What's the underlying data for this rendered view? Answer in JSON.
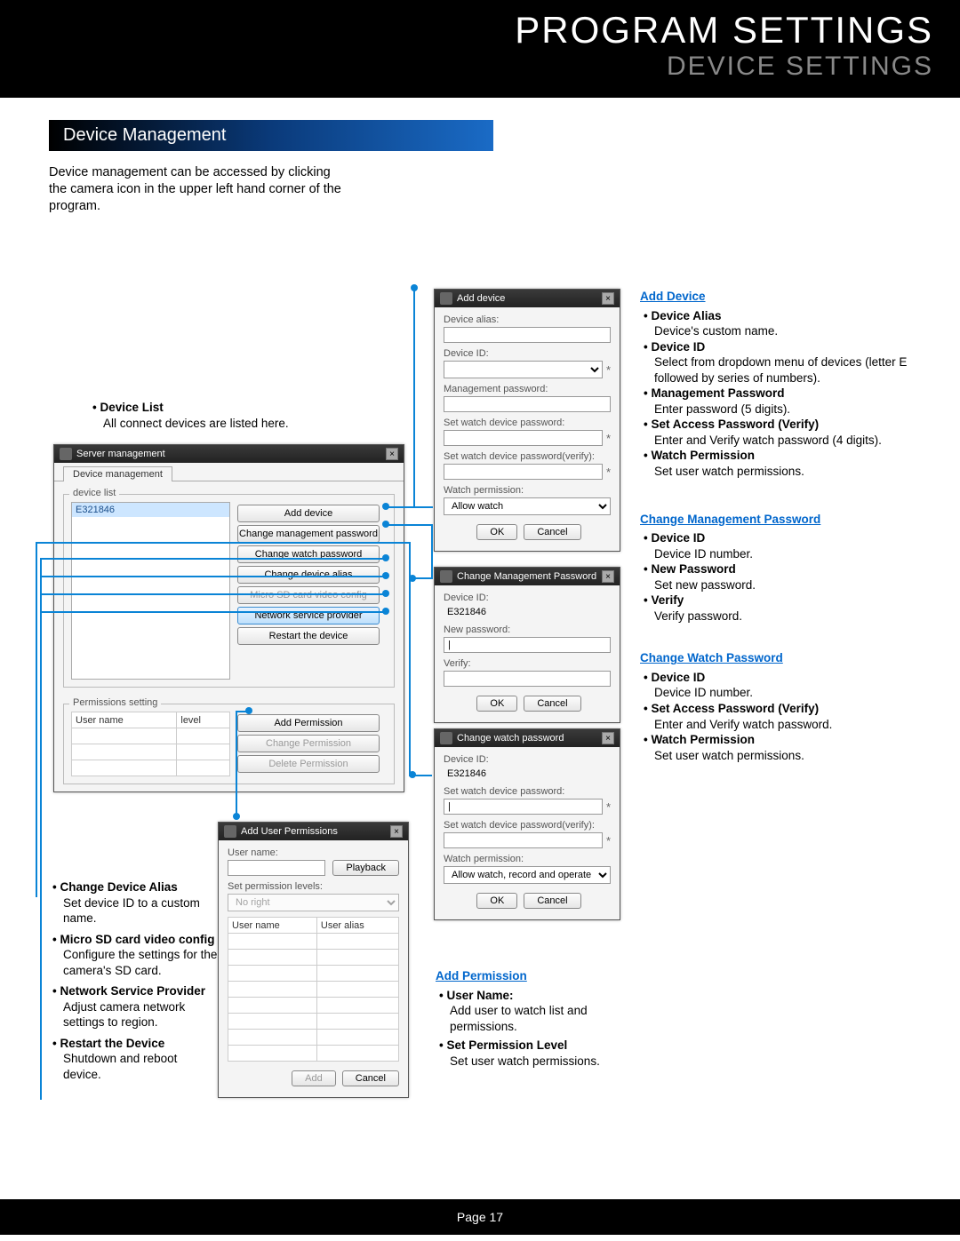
{
  "header": {
    "title": "PROGRAM SETTINGS",
    "subtitle": "DEVICE SETTINGS"
  },
  "section_banner": "Device Management",
  "intro": "Device management can be accessed by clicking the camera icon in the upper left hand corner of the program.",
  "device_list_note": {
    "title": "Device List",
    "desc": "All connect devices are listed here."
  },
  "server_mgmt": {
    "title": "Server management",
    "tab": "Device management",
    "device_list_label": "device list",
    "device_row": "E321846",
    "buttons": {
      "add": "Add device",
      "chg_mgmt": "Change management password",
      "chg_watch": "Change watch password",
      "chg_alias": "Change device alias",
      "sd": "Micro SD card video config",
      "net": "Network service provider",
      "restart": "Restart the device"
    },
    "perm_section": "Permissions setting",
    "perm_cols": {
      "user": "User name",
      "level": "level"
    },
    "perm_buttons": {
      "add": "Add Permission",
      "chg": "Change Permission",
      "del": "Delete Permission"
    }
  },
  "add_user_perm": {
    "title": "Add User Permissions",
    "user_label": "User name:",
    "playback_btn": "Playback",
    "set_perm_label": "Set permission levels:",
    "level_value": "No right",
    "cols": {
      "user": "User name",
      "alias": "User alias"
    },
    "add_btn": "Add",
    "cancel_btn": "Cancel"
  },
  "add_device": {
    "title": "Add device",
    "alias_label": "Device alias:",
    "id_label": "Device ID:",
    "mgmt_pwd_label": "Management password:",
    "set_watch_label": "Set watch device password:",
    "set_watch_verify_label": "Set watch device password(verify):",
    "watch_perm_label": "Watch permission:",
    "watch_perm_value": "Allow watch",
    "ok": "OK",
    "cancel": "Cancel"
  },
  "chg_mgmt_pwd": {
    "title": "Change Management Password",
    "id_label": "Device ID:",
    "id_value": "E321846",
    "new_pwd_label": "New password:",
    "verify_label": "Verify:",
    "ok": "OK",
    "cancel": "Cancel"
  },
  "chg_watch_pwd": {
    "title": "Change watch password",
    "id_label": "Device ID:",
    "id_value": "E321846",
    "set_watch_label": "Set watch device password:",
    "set_watch_verify_label": "Set watch device password(verify):",
    "watch_perm_label": "Watch permission:",
    "watch_perm_value": "Allow watch, record and operate",
    "ok": "OK",
    "cancel": "Cancel"
  },
  "right_notes": {
    "add_device": {
      "title": "Add Device",
      "items": [
        {
          "t": "Device Alias",
          "d": "Device's custom name."
        },
        {
          "t": "Device ID",
          "d": "Select from dropdown menu of devices (letter E followed by series of numbers)."
        },
        {
          "t": "Management Password",
          "d": "Enter password (5 digits)."
        },
        {
          "t": "Set Access Password (Verify)",
          "d": "Enter and Verify watch password (4 digits)."
        },
        {
          "t": "Watch Permission",
          "d": "Set user watch permissions."
        }
      ]
    },
    "chg_mgmt": {
      "title": "Change Management Password",
      "items": [
        {
          "t": "Device ID",
          "d": "Device ID number."
        },
        {
          "t": "New Password",
          "d": "Set new password."
        },
        {
          "t": "Verify",
          "d": "Verify password."
        }
      ]
    },
    "chg_watch": {
      "title": "Change Watch Password",
      "items": [
        {
          "t": "Device ID",
          "d": "Device ID number."
        },
        {
          "t": "Set Access Password (Verify)",
          "d": "Enter and Verify watch password."
        },
        {
          "t": "Watch Permission",
          "d": "Set user watch permissions."
        }
      ]
    }
  },
  "left_notes": [
    {
      "t": "Change Device Alias",
      "d": "Set device ID to a custom name."
    },
    {
      "t": "Micro SD card video config",
      "d": "Configure the settings for the camera's SD card."
    },
    {
      "t": "Network Service Provider",
      "d": "Adjust camera network settings to region."
    },
    {
      "t": "Restart the Device",
      "d": "Shutdown and reboot device."
    }
  ],
  "add_perm_notes": {
    "title": "Add Permission",
    "items": [
      {
        "t": "User Name:",
        "d": "Add user to watch list and permissions."
      },
      {
        "t": "Set Permission Level",
        "d": "Set user watch permissions."
      }
    ]
  },
  "footer": "Page  17"
}
